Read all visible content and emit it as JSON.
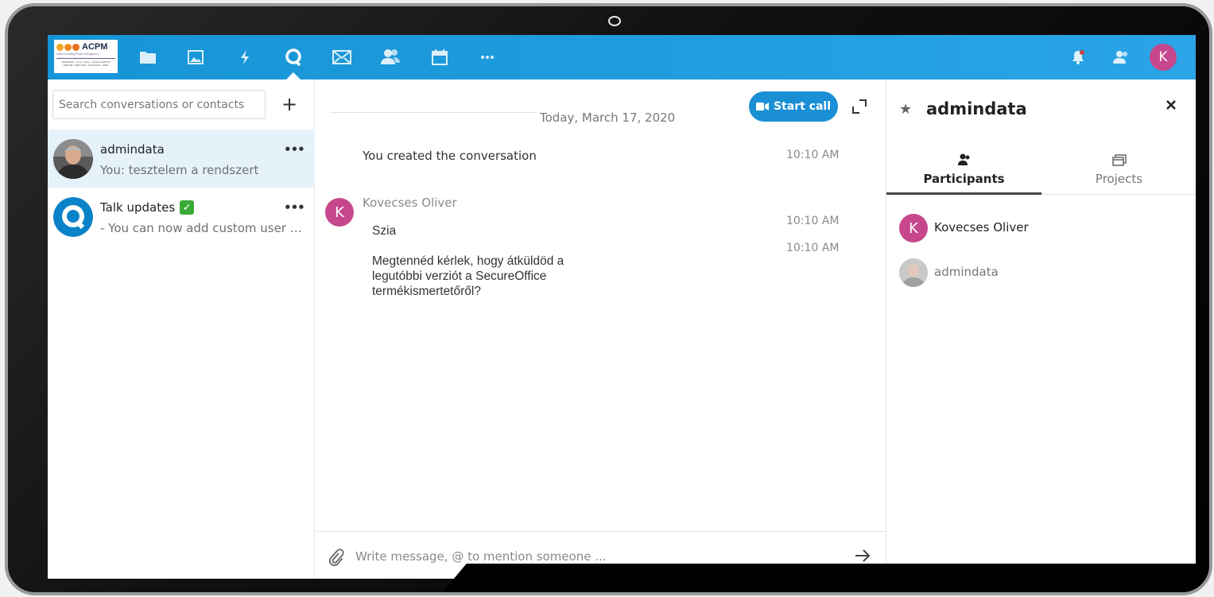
{
  "header": {
    "logo": {
      "word": "ACPM",
      "subtitle": "Audit Consulting Project Management",
      "cities_line1": "BUDAPEST · CLUJ · KOLA · KUALA LUMPUR",
      "cities_line2": "NAIROBI · PRETORIA · SHANGHAI · WIEN"
    },
    "nav_icons": [
      "files-icon",
      "photos-icon",
      "activity-icon",
      "talk-icon",
      "mail-icon",
      "contacts-icon",
      "calendar-icon",
      "more-apps-icon"
    ],
    "avatar_initial": "K",
    "colors": {
      "bar": "#2aa4e6",
      "avatar": "#c7478c"
    }
  },
  "sidebar": {
    "search_placeholder": "Search conversations or contacts",
    "add_label": "+",
    "conversations": [
      {
        "name": "admindata",
        "last": "You: tesztelem a rendszert",
        "more": "•••"
      },
      {
        "name": "Talk updates",
        "badge": "✓",
        "last": "- You can now add custom user gr...",
        "more": "•••"
      }
    ]
  },
  "chat": {
    "date": "Today, March 17, 2020",
    "start_call": "Start call",
    "system_message": "You created the conversation",
    "system_time": "10:10 AM",
    "author_initial": "K",
    "author": "Kovecses Oliver",
    "messages": [
      {
        "text": "Szia",
        "time": "10:10 AM"
      },
      {
        "line1": "Megtennéd kérlek, hogy átküldöd a",
        "line2": "legutóbbi verziót a SecureOffice",
        "line3": "termékismertetőről?",
        "time": "10:10 AM"
      }
    ],
    "composer_placeholder": "Write message, @ to mention someone ..."
  },
  "right_panel": {
    "title": "admindata",
    "tabs": [
      {
        "label": "Participants",
        "icon": "participants-icon"
      },
      {
        "label": "Projects",
        "icon": "projects-icon"
      }
    ],
    "participants": [
      {
        "initial": "K",
        "name": "Kovecses Oliver"
      },
      {
        "name": "admindata"
      }
    ]
  }
}
